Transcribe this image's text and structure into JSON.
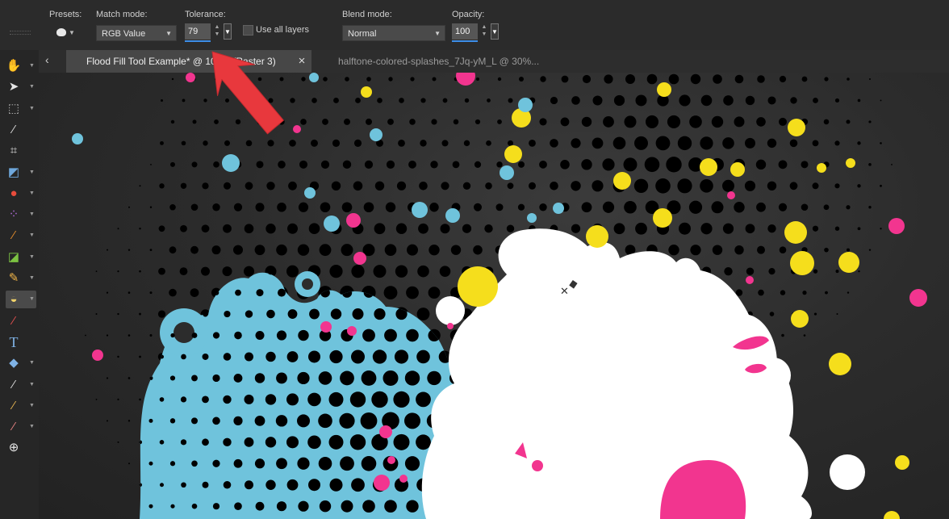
{
  "options_bar": {
    "presets_label": "Presets:",
    "match_mode_label": "Match mode:",
    "match_mode_value": "RGB Value",
    "tolerance_label": "Tolerance:",
    "tolerance_value": "79",
    "use_all_layers_label": "Use all layers",
    "use_all_layers_checked": false,
    "blend_mode_label": "Blend mode:",
    "blend_mode_value": "Normal",
    "opacity_label": "Opacity:",
    "opacity_value": "100"
  },
  "toolbar": {
    "active_tool": "flood-fill-tool",
    "tools": [
      {
        "name": "pan-tool",
        "icon": "hand-icon",
        "glyph": "✋",
        "color": "#f1c21c",
        "caret": true
      },
      {
        "name": "pick-tool",
        "icon": "pointer-icon",
        "glyph": "➤",
        "color": "#e6e6e6",
        "caret": true
      },
      {
        "name": "selection-tool",
        "icon": "marquee-icon",
        "glyph": "⬚",
        "color": "#bdbdbd",
        "caret": true
      },
      {
        "name": "magic-wand-tool",
        "icon": "magic-wand-icon",
        "glyph": "⁄",
        "color": "#d8d8d8",
        "caret": false
      },
      {
        "name": "crop-tool",
        "icon": "crop-icon",
        "glyph": "⌗",
        "color": "#d8d8d8",
        "caret": false
      },
      {
        "name": "straighten-tool",
        "icon": "straighten-icon",
        "glyph": "◩",
        "color": "#6fa8dc",
        "caret": true
      },
      {
        "name": "red-eye-tool",
        "icon": "eye-icon",
        "glyph": "●",
        "color": "#e74c3c",
        "caret": true
      },
      {
        "name": "clone-brush-tool",
        "icon": "clone-icon",
        "glyph": "⁘",
        "color": "#b36bdb",
        "caret": true
      },
      {
        "name": "paint-brush-tool",
        "icon": "brush-icon",
        "glyph": "⁄",
        "color": "#e08a2c",
        "caret": true
      },
      {
        "name": "color-replacer-tool",
        "icon": "color-replacer-icon",
        "glyph": "◪",
        "color": "#7cc242",
        "caret": true
      },
      {
        "name": "pencil-tool",
        "icon": "pencil-icon",
        "glyph": "✎",
        "color": "#f4b74a",
        "caret": true
      },
      {
        "name": "flood-fill-tool",
        "icon": "paint-bucket-icon",
        "glyph": "◒",
        "color": "#f1d36a",
        "caret": true
      },
      {
        "name": "color-picker-tool",
        "icon": "dropper-icon",
        "glyph": "⁄",
        "color": "#e05050",
        "caret": false
      },
      {
        "name": "text-tool",
        "icon": "text-icon",
        "glyph": "T",
        "color": "#7fb2e5",
        "caret": false
      },
      {
        "name": "shape-tool",
        "icon": "speech-bubble-icon",
        "glyph": "◆",
        "color": "#7fb2e5",
        "caret": true
      },
      {
        "name": "pen-tool",
        "icon": "pen-icon",
        "glyph": "⁄",
        "color": "#d8d8d8",
        "caret": true
      },
      {
        "name": "warp-brush-tool",
        "icon": "warp-brush-icon",
        "glyph": "⁄",
        "color": "#e0b050",
        "caret": true
      },
      {
        "name": "eraser-tool",
        "icon": "eraser-icon",
        "glyph": "⁄",
        "color": "#e08080",
        "caret": true
      },
      {
        "name": "add-tool",
        "icon": "plus-circle-icon",
        "glyph": "⊕",
        "color": "#e6e6e6",
        "caret": false
      }
    ]
  },
  "tabs": [
    {
      "label": "Flood Fill Tool Example* @ 100% (Raster 3)",
      "active": true
    },
    {
      "label": "halftone-colored-splashes_7Jq-yM_L  @   30%...",
      "active": false
    }
  ],
  "tab_close_glyph": "×",
  "tab_scroll_glyph": "‹",
  "colors": {
    "canvas_bg": "#2c2c2c",
    "cyan": "#6fc3dc",
    "magenta": "#f2358f",
    "yellow": "#f5de1c",
    "white_fill": "#ffffff",
    "dot": "#000000",
    "annotation_arrow": "#e8383d",
    "accent": "#3d8ee8"
  }
}
